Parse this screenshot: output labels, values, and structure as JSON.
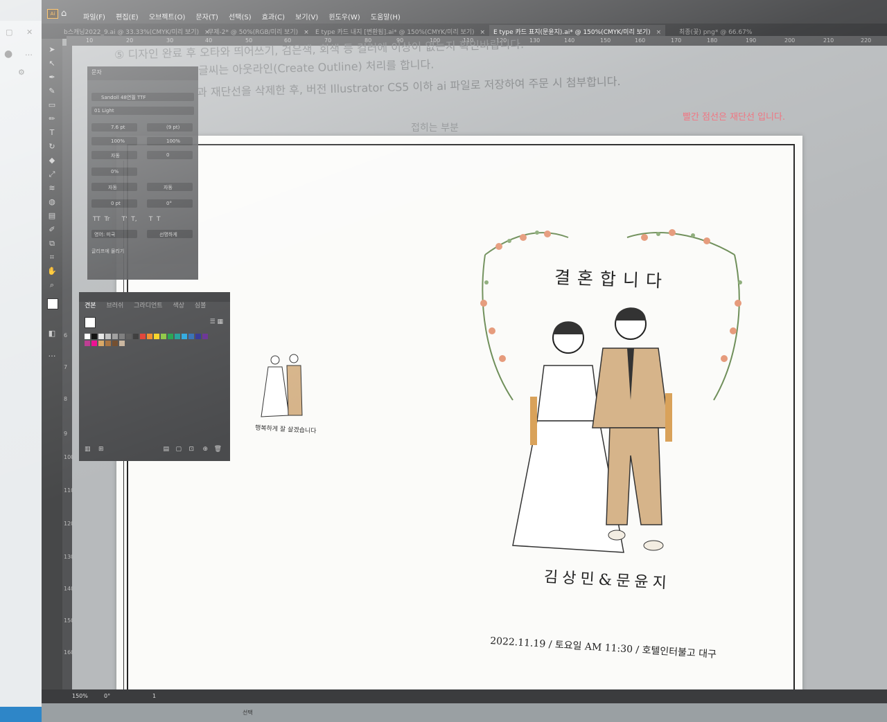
{
  "menubar": {
    "items": [
      "파일(F)",
      "편집(E)",
      "오브젝트(O)",
      "문자(T)",
      "선택(S)",
      "효과(C)",
      "보기(V)",
      "윈도우(W)",
      "도움말(H)"
    ]
  },
  "tabs": [
    {
      "label": "b스캐닝2022_9.ai @ 33.33%(CMYK/미리 보기)"
    },
    {
      "label": "무제-2* @ 50%(RGB/미리 보기)"
    },
    {
      "label": "E type 카드 내지 [변환됨].ai* @ 150%(CMYK/미리 보기)"
    },
    {
      "label": "E type 카드 표지(문윤지).ai* @ 150%(CMYK/미리 보기)"
    },
    {
      "label": "최종(꽃) png* @ 66.67%"
    }
  ],
  "ruler_top": [
    "10",
    "20",
    "30",
    "40",
    "50",
    "60",
    "70",
    "80",
    "90",
    "100",
    "110",
    "120",
    "130",
    "140",
    "150",
    "160",
    "170",
    "180",
    "190",
    "200",
    "210",
    "220"
  ],
  "ruler_left": [
    "6",
    "7",
    "8",
    "9",
    "100",
    "110",
    "120",
    "130",
    "140",
    "150",
    "160"
  ],
  "instructions": {
    "line1": "⑤ 디자인 완료 후 오타와 띄어쓰기, 검은색, 회색 등 컬러에 이상이 없는지 확인바랍니다.",
    "line2": "글씨는 아웃라인(Create Outline) 처리를 합니다.",
    "line3": "과 재단선을 삭제한 후, 버전 Illustrator CS5 이하 ai 파일로 저장하여 주문 시 첨부합니다."
  },
  "canvas": {
    "fold_label": "접히는 부분",
    "red_note": "빨간 점선은 재단선 입니다."
  },
  "card": {
    "title": "결혼합니다",
    "names": "김상민&문윤지",
    "date_line": "2022.11.19 / 토요일 AM 11:30 / 호텔인터불고 대구",
    "small_caption": "행복하게 잘 살겠습니다"
  },
  "char_panel": {
    "title": "문자",
    "font_family": "Sandoll 48연필 TTF",
    "font_style": "01 Light",
    "size": "7.6 pt",
    "leading": "(9 pt)",
    "v_scale": "100%",
    "h_scale": "100%",
    "kerning": "자동",
    "tracking": "0",
    "rotation": "0%",
    "auto1": "자동",
    "auto2": "자동",
    "baseline": "0 pt",
    "char_rotation": "0°",
    "language": "영어: 미국",
    "antialias": "선명하게",
    "glyph_snap": "글리프에 물리기"
  },
  "swatch_panel": {
    "tabs": [
      "견본",
      "브러쉬",
      "그라디언트",
      "색상",
      "심볼"
    ],
    "colors": [
      "#ffffff",
      "#000000",
      "#e5e5e5",
      "#bdbdbd",
      "#9a9a9a",
      "#777777",
      "#555555",
      "#333333",
      "#e03a2e",
      "#f08a24",
      "#f6d21f",
      "#8cc63f",
      "#1fa14a",
      "#1b9e96",
      "#2aa7df",
      "#2f6db3",
      "#2e3192",
      "#662d91",
      "#b9308b",
      "#ec008c",
      "#d6a25c",
      "#a46b35",
      "#6b4423",
      "#c7b299"
    ]
  },
  "statusbar": {
    "zoom": "150%",
    "rotate": "0°",
    "page": "1",
    "selection": "선택"
  },
  "colors": {
    "app_bg": "#3a3b3d",
    "artboard": "#fbfbf9",
    "accent_note": "#f06b78"
  }
}
